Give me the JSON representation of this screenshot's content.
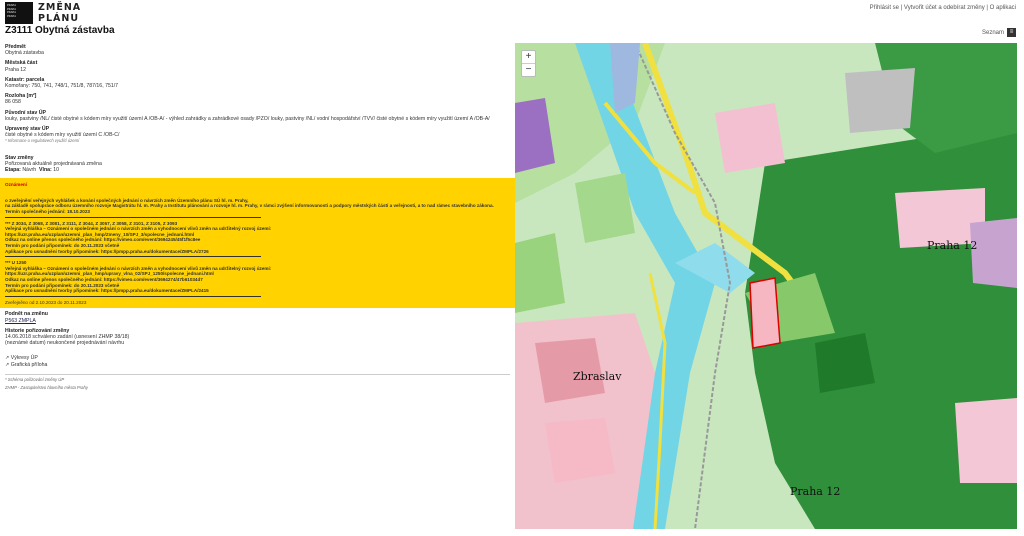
{
  "header": {
    "brand_line1": "ZMĚNA",
    "brand_line2": "PLÁNU",
    "logo_text": "PRAHA\nPRAHA\nPRAHA\nPRAHA",
    "title": "Z3111 Obytná zástavba"
  },
  "topnav": {
    "login": "Přihlásit se",
    "signup": "Vytvořit účet a odebírat změny",
    "about": "O aplikaci",
    "sep": "|"
  },
  "legend_button": {
    "label": "Seznam",
    "icon": "list-icon"
  },
  "detail": {
    "subject_label": "Předmět",
    "subject_value": "Obytná zástavba",
    "district_label": "Městská část",
    "district_value": "Praha 12",
    "cadastre_label": "Katastr: parcela",
    "cadastre_value": "Komořany: 750, 741, 748/1, 751/8, 787/16, 751/7",
    "area_label": "Rozloha [m²]",
    "area_value": "86 058",
    "original_label": "Původní stav ÚP",
    "original_value": "louky, pastviny /NL/ čisté obytné s kódem míry využití území A /OB-A/ - výhled zahrádky a zahrádkové osady /PZO/ louky, pastviny /NL/ vodní hospodářství /TVV/ čisté obytné s kódem míry využití území A /OB-A/",
    "modified_label": "Upravený stav ÚP",
    "modified_value": "čisté obytné s kódem míry využití území C /OB-C/",
    "modified_note": "* Informace o regulativech využití území",
    "state_label": "Stav změny",
    "state_value": "Pořizovaná aktuálně projednávaná změna",
    "stage_label": "Etapa:",
    "stage_value": "Návrh",
    "wave_label": "Vlna:",
    "wave_value": "10"
  },
  "announcement": {
    "heading": "Oznámení",
    "p1": "o zveřejnění veřejných vyhlášek a konání společných jednání o návrzích změn Územního plánu SÚ hl. m. Prahy,",
    "p2": "na základě spolupráce odboru územního rozvoje Magistrátu hl. m. Prahy a Institutu plánování a rozvoje hl. m. Prahy, v rámci zvýšení informovanosti a podpory městských částí a veřejnosti, a to nad rámec stavebního zákona.",
    "p3": "Termín společného jednání: 18.10.2023",
    "b1_1": "*** Z 3034, Z 3068, Z 3081, Z 3111, Z 3044, Z 3057, Z 3058, Z 3101, Z 3105, Z 3093",
    "b1_2": "Veřejná vyhláška – Oznámení o společném jednání o návrzích změn a vyhodnocení vlivů změn na udržitelný rozvoj území:",
    "b1_3": "https://uzr.praha.eu/uzplan/uzemni_plan_hmp/Zmeny_10/SPJ_3/spolecne_jednani.html",
    "b1_4": "Odkaz na online přenos společného jednání: https://vimeo.com/event/3694245/45f1f5c8ee",
    "b1_5": "Termín pro podání připomínek: do 20.11.2023 včetně",
    "b1_6": "Aplikace pro usnadnění tvorby připomínek: https://pmpp.praha.eu/dokumentace/ZMPLA/2726",
    "b2_1": "*** U 1250",
    "b2_2": "Veřejná vyhláška – Oznámení o společném jednání o návrzích změn a vyhodnocení vlivů změn na udržitelný rozvoj území:",
    "b2_3": "https://uzr.praha.eu/uzplan/uzemni_plan_hmp/upravy_vlna_02/SPJ_1250/spolecne_jednani.html",
    "b2_4": "Odkaz na online přenos společného jednání: https://vimeo.com/event/3694274/47b61034d7",
    "b2_5": "Termín pro podání připomínek: do 20.11.2023 včetně",
    "b2_6": "Aplikace pro usnadnění tvorby připomínek: https://pmpp.praha.eu/dokumentace/ZMPLA/2415",
    "dates": "Zveřejněno od 2.10.2023 do 20.11.2023"
  },
  "submitter": {
    "label": "Podnět na změnu",
    "value": "P563 ZMPLA"
  },
  "history": {
    "label": "Historie pořizování změny",
    "line1": "14.06.2018 schváleno zadání (usnesení ZHMP 38/18)",
    "line2": "(neznámé datum) neukončené projednávání návrhu"
  },
  "links": {
    "scheme": "↗ Výkresy ÚP",
    "graphic": "↗ Grafická příloha"
  },
  "footnotes": {
    "f1": "* Schéma pořizování změny ÚP",
    "f2": "ZHMP - Zastupitelstvo hlavního města Prahy"
  },
  "map": {
    "zoom_in": "+",
    "zoom_out": "−",
    "label_praha12_a": "Praha 12",
    "label_praha12_b": "Praha 12",
    "label_zbraslav": "Zbraslav",
    "colors": {
      "forest": "#2e8b2e",
      "meadow": "#b8e09a",
      "residential": "#f2c6d2",
      "water": "#6fd6e8",
      "road": "#f4e84a",
      "industrial": "#c7a7c9"
    }
  }
}
